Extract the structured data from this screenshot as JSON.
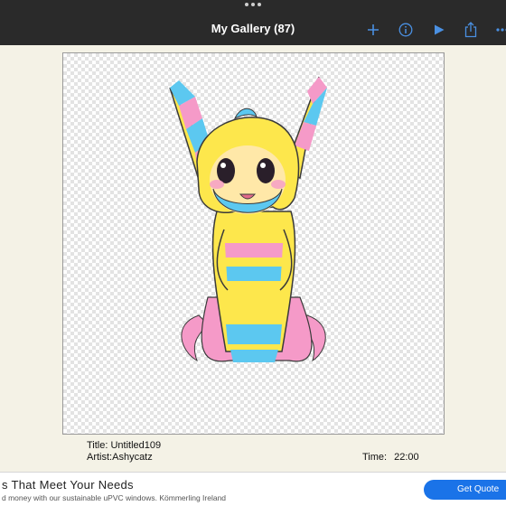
{
  "header": {
    "title": "My Gallery (87)",
    "icons": [
      "add-icon",
      "info-icon",
      "play-icon",
      "share-icon",
      "more-icon"
    ]
  },
  "artwork": {
    "title_line": "Title: Untitled109",
    "artist_line": "Artist:Ashycatz",
    "time_label": "Time:",
    "time_value": "22:00"
  },
  "ad": {
    "headline": "s That Meet Your Needs",
    "subtext": "d money with our sustainable uPVC windows. Kömmerling Ireland",
    "cta_label": "Get Quote"
  },
  "colors": {
    "topbar": "#2a2a2a",
    "accent": "#4a90e2",
    "background": "#f4f2e6",
    "cta": "#1a73e8"
  }
}
